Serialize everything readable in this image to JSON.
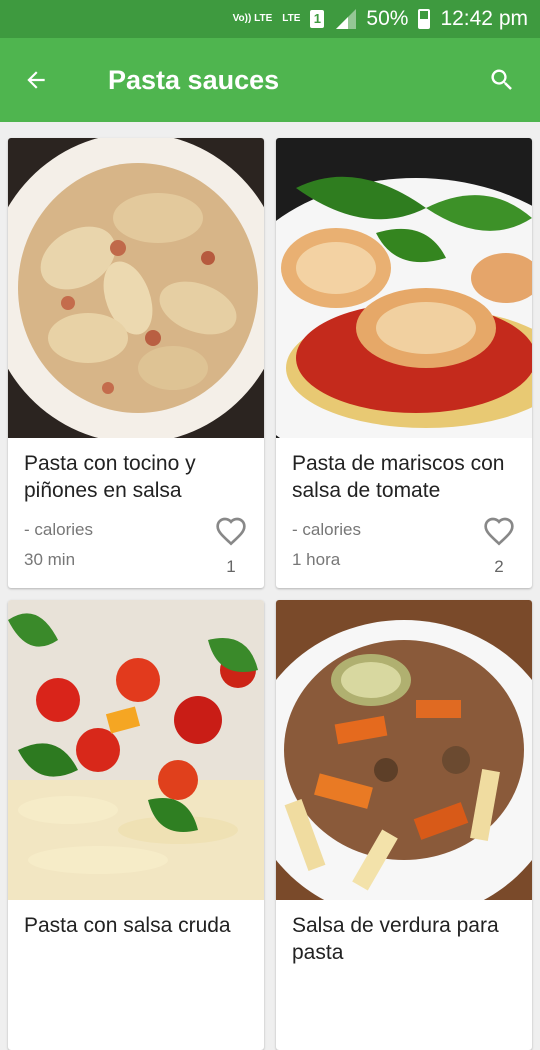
{
  "status": {
    "volte": "Vo)) LTE",
    "lte": "LTE",
    "sim": "1",
    "battery": "50%",
    "time": "12:42 pm"
  },
  "appbar": {
    "title": "Pasta sauces"
  },
  "recipes": [
    {
      "name": "Pasta con tocino y piñones en salsa",
      "calories": "- calories",
      "time": "30 min",
      "likes": "1"
    },
    {
      "name": "Pasta de mariscos con salsa de tomate",
      "calories": "- calories",
      "time": "1 hora",
      "likes": "2"
    },
    {
      "name": "Pasta con salsa cruda",
      "calories": "",
      "time": "",
      "likes": ""
    },
    {
      "name": "Salsa de verdura para pasta",
      "calories": "",
      "time": "",
      "likes": ""
    }
  ],
  "colors": {
    "status_bar": "#3e9a3f",
    "app_bar": "#4fb54f"
  }
}
